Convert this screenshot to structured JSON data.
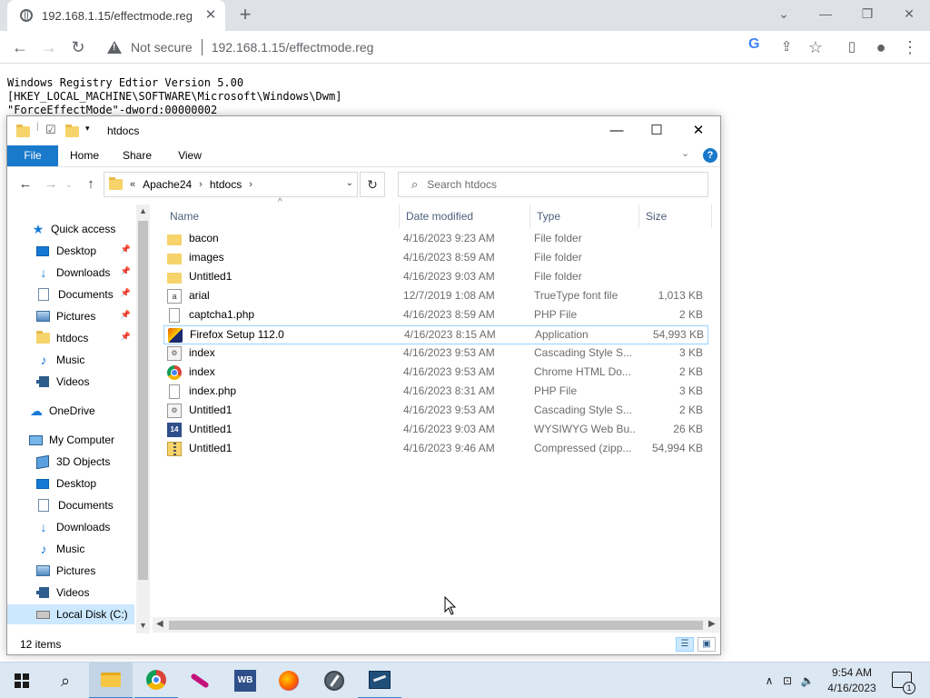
{
  "browser": {
    "tab_title": "192.168.1.15/effectmode.reg",
    "security_label": "Not secure",
    "url": "192.168.1.15/effectmode.reg"
  },
  "page": {
    "lines": [
      "Windows Registry Edtior Version 5.00",
      "[HKEY_LOCAL_MACHINE\\SOFTWARE\\Microsoft\\Windows\\Dwm]",
      "\"ForceEffectMode\"-dword:00000002"
    ]
  },
  "explorer": {
    "title": "htdocs",
    "ribbon_tabs": [
      "File",
      "Home",
      "Share",
      "View"
    ],
    "breadcrumb_prefix": "«",
    "breadcrumb": [
      "Apache24",
      "htdocs"
    ],
    "search_placeholder": "Search htdocs",
    "sidebar": [
      {
        "label": "Quick access",
        "icon": "star-icon"
      },
      {
        "label": "Desktop",
        "icon": "desktop-icon",
        "pinned": true
      },
      {
        "label": "Downloads",
        "icon": "download-icon",
        "pinned": true
      },
      {
        "label": "Documents",
        "icon": "document-icon",
        "pinned": true
      },
      {
        "label": "Pictures",
        "icon": "pictures-icon",
        "pinned": true
      },
      {
        "label": "htdocs",
        "icon": "folder-icon",
        "pinned": true
      },
      {
        "label": "Music",
        "icon": "music-icon"
      },
      {
        "label": "Videos",
        "icon": "video-icon"
      },
      {
        "label": "OneDrive",
        "icon": "cloud-icon"
      },
      {
        "label": "My Computer",
        "icon": "computer-icon"
      },
      {
        "label": "3D Objects",
        "icon": "cube-icon"
      },
      {
        "label": "Desktop",
        "icon": "desktop-icon"
      },
      {
        "label": "Documents",
        "icon": "document-icon"
      },
      {
        "label": "Downloads",
        "icon": "download-icon"
      },
      {
        "label": "Music",
        "icon": "music-icon"
      },
      {
        "label": "Pictures",
        "icon": "pictures-icon"
      },
      {
        "label": "Videos",
        "icon": "video-icon"
      },
      {
        "label": "Local Disk (C:)",
        "icon": "drive-icon",
        "selected": true
      }
    ],
    "columns": [
      "Name",
      "Date modified",
      "Type",
      "Size"
    ],
    "files": [
      {
        "name": "bacon",
        "date": "4/16/2023 9:23 AM",
        "type": "File folder",
        "size": "",
        "icon": "folder"
      },
      {
        "name": "images",
        "date": "4/16/2023 8:59 AM",
        "type": "File folder",
        "size": "",
        "icon": "folder"
      },
      {
        "name": "Untitled1",
        "date": "4/16/2023 9:03 AM",
        "type": "File folder",
        "size": "",
        "icon": "folder"
      },
      {
        "name": "arial",
        "date": "12/7/2019 1:08 AM",
        "type": "TrueType font file",
        "size": "1,013 KB",
        "icon": "font"
      },
      {
        "name": "captcha1.php",
        "date": "4/16/2023 8:59 AM",
        "type": "PHP File",
        "size": "2 KB",
        "icon": "file"
      },
      {
        "name": "Firefox Setup 112.0",
        "date": "4/16/2023 8:15 AM",
        "type": "Application",
        "size": "54,993 KB",
        "icon": "app",
        "hovered": true
      },
      {
        "name": "index",
        "date": "4/16/2023 9:53 AM",
        "type": "Cascading Style S...",
        "size": "3 KB",
        "icon": "css"
      },
      {
        "name": "index",
        "date": "4/16/2023 9:53 AM",
        "type": "Chrome HTML Do...",
        "size": "2 KB",
        "icon": "chrome"
      },
      {
        "name": "index.php",
        "date": "4/16/2023 8:31 AM",
        "type": "PHP File",
        "size": "3 KB",
        "icon": "file"
      },
      {
        "name": "Untitled1",
        "date": "4/16/2023 9:53 AM",
        "type": "Cascading Style S...",
        "size": "2 KB",
        "icon": "css"
      },
      {
        "name": "Untitled1",
        "date": "4/16/2023 9:03 AM",
        "type": "WYSIWYG Web Bu...",
        "size": "26 KB",
        "icon": "wysiwyg"
      },
      {
        "name": "Untitled1",
        "date": "4/16/2023 9:46 AM",
        "type": "Compressed (zipp...",
        "size": "54,994 KB",
        "icon": "zip"
      }
    ],
    "status": "12 items"
  },
  "taskbar": {
    "time": "9:54 AM",
    "date": "4/16/2023",
    "notification_count": "1",
    "wysiwyg_label": "WB 14"
  },
  "colors": {
    "accent": "#1979ca",
    "selection": "#cce8ff",
    "taskbar": "#dbe7f3"
  }
}
